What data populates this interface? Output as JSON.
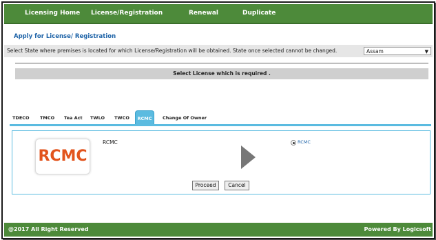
{
  "nav": {
    "items": [
      "Licensing Home",
      "License/Registration",
      "Renewal",
      "Duplicate"
    ]
  },
  "page": {
    "heading": "Apply for License/ Registration",
    "state_prompt": "Select State where premises is located for which License/Registration will be obtained. State once selected cannot be changed.",
    "state_selected": "Assam",
    "license_prompt": "Select License which is required ."
  },
  "tabs": [
    "TDECO",
    "TMCO",
    "Tea Act",
    "TWLO",
    "TWCO",
    "RCMC",
    "Change Of Owner"
  ],
  "active_tab": "RCMC",
  "panel": {
    "logo_text": "RCMC",
    "license_name": "RCMC",
    "radio_label": "RCMC",
    "proceed_label": "Proceed",
    "cancel_label": "Cancel"
  },
  "footer": {
    "copyright": "@2017 All Right Reserved",
    "powered": "Powered By Logicsoft"
  },
  "colors": {
    "nav_green": "#4d8a3a",
    "tab_active": "#5bbbe0",
    "heading_blue": "#1f64a8",
    "logo_orange": "#e2541d"
  },
  "icons": {
    "play": "play-arrow-icon",
    "dropdown": "chevron-down-icon"
  }
}
